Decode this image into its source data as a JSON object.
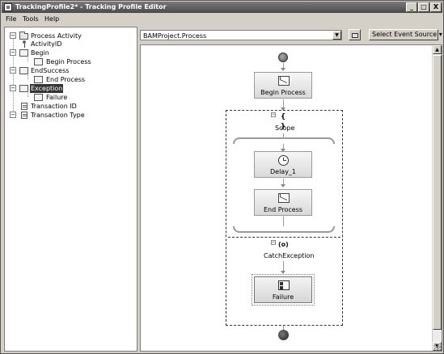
{
  "window": {
    "title": "TrackingProfile2* - Tracking Profile Editor",
    "minimize_glyph": "_",
    "maximize_glyph": "□",
    "close_glyph": "X"
  },
  "menu": {
    "items": [
      "File",
      "Tools",
      "Help"
    ]
  },
  "tree": {
    "items": [
      {
        "label": "Process Activity",
        "icon": "folder-icon",
        "expander": "−"
      },
      {
        "label": "ActivityID",
        "icon": "pin-icon",
        "expander": ""
      },
      {
        "label": "Begin",
        "icon": "activity-shape-icon",
        "expander": "−"
      },
      {
        "label": "Begin Process",
        "icon": "activity-shape-icon",
        "expander": ""
      },
      {
        "label": "EndSuccess",
        "icon": "activity-shape-icon",
        "expander": "−"
      },
      {
        "label": "End Process",
        "icon": "activity-shape-icon",
        "expander": ""
      },
      {
        "label": "Exception",
        "icon": "activity-shape-icon",
        "expander": "−",
        "selected": true
      },
      {
        "label": "Failure",
        "icon": "activity-shape-icon",
        "expander": ""
      },
      {
        "label": "Transaction ID",
        "icon": "document-icon",
        "expander": ""
      },
      {
        "label": "Transaction Type",
        "icon": "document-icon",
        "expander": "−"
      }
    ]
  },
  "toolbar": {
    "source_value": "BAMProject.Process",
    "dropdown_arrow": "▼",
    "select_event_source": "Select Event Source ▾"
  },
  "workflow": {
    "activities": {
      "begin_process": "Begin Process",
      "delay": "Delay_1",
      "end_process": "End Process",
      "failure": "Failure"
    },
    "scope_label": "Scope",
    "scope_glyph": "{ }",
    "catch_label": "CatchException",
    "catch_glyph": "(o)",
    "collapse_glyph": "−"
  },
  "scrollbar": {
    "up_glyph": "▲",
    "down_glyph": "▼"
  }
}
